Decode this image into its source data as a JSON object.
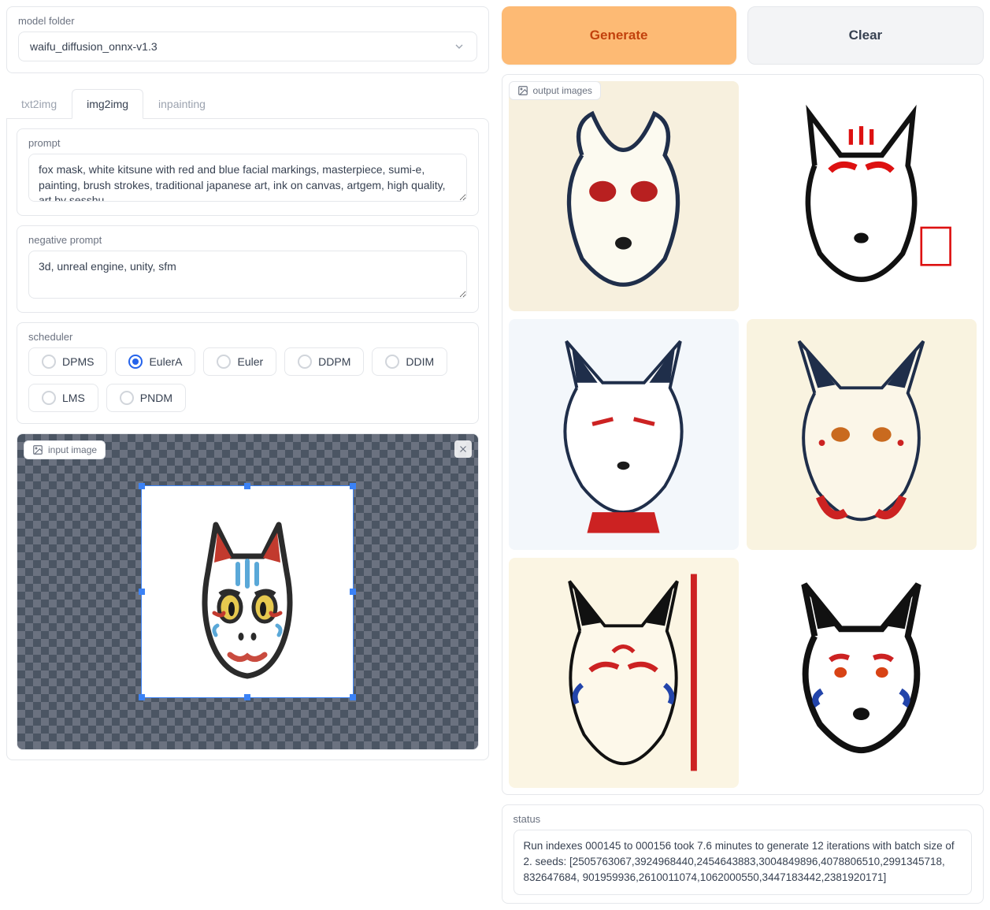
{
  "modelFolder": {
    "label": "model folder",
    "value": "waifu_diffusion_onnx-v1.3"
  },
  "tabs": [
    "txt2img",
    "img2img",
    "inpainting"
  ],
  "activeTab": "img2img",
  "prompt": {
    "label": "prompt",
    "value": "fox mask, white kitsune with red and blue facial markings, masterpiece, sumi-e, painting, brush strokes, traditional japanese art, ink on canvas, artgem, high quality, art by sesshu"
  },
  "negativePrompt": {
    "label": "negative prompt",
    "value": "3d, unreal engine, unity, sfm"
  },
  "scheduler": {
    "label": "scheduler",
    "options": [
      "DPMS",
      "EulerA",
      "Euler",
      "DDPM",
      "DDIM",
      "LMS",
      "PNDM"
    ],
    "selected": "EulerA"
  },
  "inputImage": {
    "label": "input image"
  },
  "buttons": {
    "generate": "Generate",
    "clear": "Clear"
  },
  "outputImages": {
    "label": "output images"
  },
  "status": {
    "label": "status",
    "text": "Run indexes 000145 to 000156 took 7.6 minutes to generate 12 iterations with batch size of 2. seeds: [2505763067,3924968440,2454643883,3004849896,4078806510,2991345718, 832647684, 901959936,2610011074,1062000550,3447183442,2381920171]"
  }
}
